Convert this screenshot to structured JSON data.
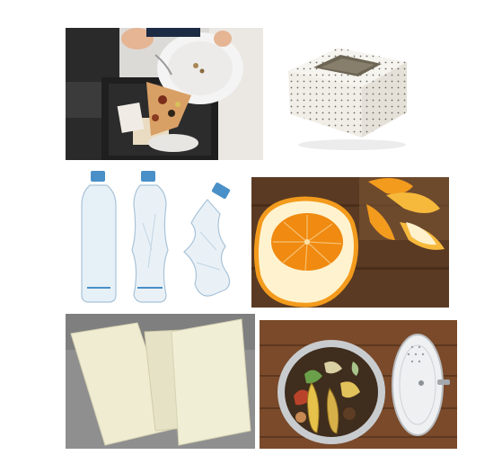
{
  "tiles": [
    {
      "name": "food-scraps-photo"
    },
    {
      "name": "cake-box-photo"
    },
    {
      "name": "plastic-bottles-photo"
    },
    {
      "name": "peeled-orange-photo"
    },
    {
      "name": "paper-sheets-photo"
    },
    {
      "name": "compost-bin-photo"
    }
  ],
  "colors": {
    "background": "#ffffff",
    "counter_dark": "#2a2a2a",
    "pizza_crust": "#d9a066",
    "box_white": "#f6f4ef",
    "bottle_blue": "#4a90c8",
    "orange": "#f39b1d",
    "wood_dark": "#5a3a22",
    "paper_cream": "#efecd2",
    "compost_wood": "#7a4a2a"
  }
}
